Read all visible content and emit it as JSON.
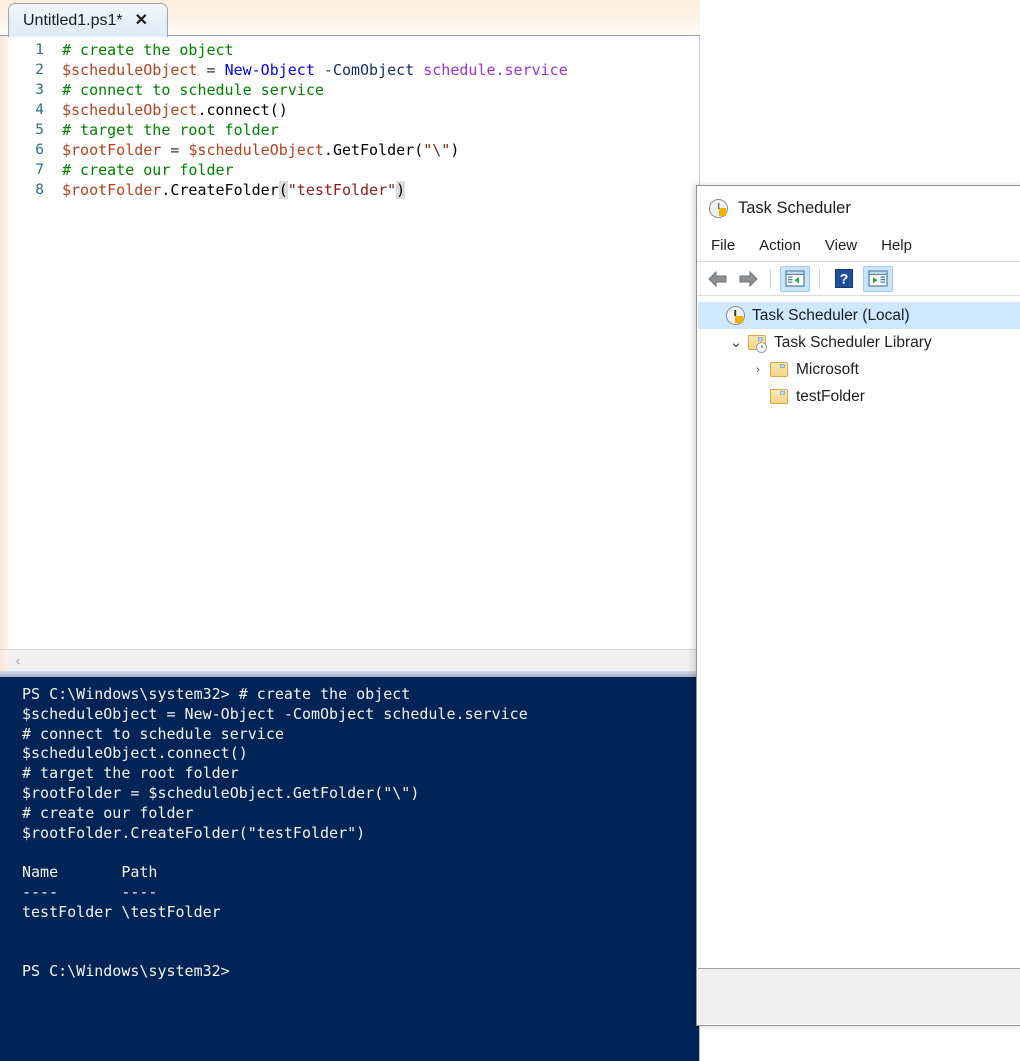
{
  "ise": {
    "tab": {
      "title": "Untitled1.ps1*",
      "close_label": "✕"
    },
    "editor": {
      "lines": [
        {
          "number": "1",
          "tokens": [
            {
              "t": "# create the object",
              "c": "c-comment"
            }
          ]
        },
        {
          "number": "2",
          "tokens": [
            {
              "t": "$scheduleObject",
              "c": "c-var"
            },
            {
              "t": " = ",
              "c": "c-op"
            },
            {
              "t": "New-Object",
              "c": "c-cmdlet"
            },
            {
              "t": " ",
              "c": "c-op"
            },
            {
              "t": "-ComObject",
              "c": "c-param"
            },
            {
              "t": " ",
              "c": "c-op"
            },
            {
              "t": "schedule.service",
              "c": "c-arg"
            }
          ]
        },
        {
          "number": "3",
          "tokens": [
            {
              "t": "# connect to schedule service",
              "c": "c-comment"
            }
          ]
        },
        {
          "number": "4",
          "tokens": [
            {
              "t": "$scheduleObject",
              "c": "c-var"
            },
            {
              "t": ".",
              "c": "c-punct"
            },
            {
              "t": "connect",
              "c": "c-member"
            },
            {
              "t": "()",
              "c": "c-punct"
            }
          ]
        },
        {
          "number": "5",
          "tokens": [
            {
              "t": "# target the root folder",
              "c": "c-comment"
            }
          ]
        },
        {
          "number": "6",
          "tokens": [
            {
              "t": "$rootFolder",
              "c": "c-var"
            },
            {
              "t": " = ",
              "c": "c-op"
            },
            {
              "t": "$scheduleObject",
              "c": "c-var"
            },
            {
              "t": ".",
              "c": "c-punct"
            },
            {
              "t": "GetFolder",
              "c": "c-member"
            },
            {
              "t": "(",
              "c": "c-punct"
            },
            {
              "t": "\"\\\"",
              "c": "c-string"
            },
            {
              "t": ")",
              "c": "c-punct"
            }
          ]
        },
        {
          "number": "7",
          "tokens": [
            {
              "t": "# create our folder",
              "c": "c-comment"
            }
          ]
        },
        {
          "number": "8",
          "tokens": [
            {
              "t": "$rootFolder",
              "c": "c-var"
            },
            {
              "t": ".",
              "c": "c-punct"
            },
            {
              "t": "CreateFolder",
              "c": "c-member"
            },
            {
              "t": "(",
              "c": "c-bracket-hl"
            },
            {
              "t": "\"testFolder\"",
              "c": "c-string"
            },
            {
              "t": ")",
              "c": "c-bracket-hl"
            }
          ]
        }
      ]
    },
    "hscroll": {
      "left_arrow": "‹"
    },
    "console": {
      "lines": [
        "PS C:\\Windows\\system32> # create the object",
        "$scheduleObject = New-Object -ComObject schedule.service",
        "# connect to schedule service",
        "$scheduleObject.connect()",
        "# target the root folder",
        "$rootFolder = $scheduleObject.GetFolder(\"\\\")",
        "# create our folder",
        "$rootFolder.CreateFolder(\"testFolder\")",
        "",
        "Name       Path",
        "----       ----",
        "testFolder \\testFolder",
        "",
        "",
        "PS C:\\Windows\\system32>"
      ]
    }
  },
  "task_scheduler": {
    "title": "Task Scheduler",
    "menu": [
      {
        "label": "File"
      },
      {
        "label": "Action"
      },
      {
        "label": "View"
      },
      {
        "label": "Help"
      }
    ],
    "toolbar": {
      "back": "back-arrow",
      "forward": "forward-arrow",
      "show_tree": "show-console-tree",
      "help": "?",
      "show_action_pane": "show-action-pane"
    },
    "tree": [
      {
        "label": "Task Scheduler (Local)",
        "indent": 0,
        "chevron": "",
        "icon": "clock",
        "selected": true
      },
      {
        "label": "Task Scheduler Library",
        "indent": 1,
        "chevron": "⌄",
        "icon": "folder-clock",
        "selected": false
      },
      {
        "label": "Microsoft",
        "indent": 2,
        "chevron": "›",
        "icon": "folder",
        "selected": false
      },
      {
        "label": "testFolder",
        "indent": 2,
        "chevron": "",
        "icon": "folder",
        "selected": false
      }
    ]
  },
  "colors": {
    "console_bg": "#012456",
    "tree_selection": "#cde8ff",
    "tab_bg": "#e4eef8",
    "comment": "#008000",
    "variable": "#b5401f",
    "cmdlet": "#0000ee",
    "argument": "#9b30d9",
    "string": "#8b1a1a"
  }
}
